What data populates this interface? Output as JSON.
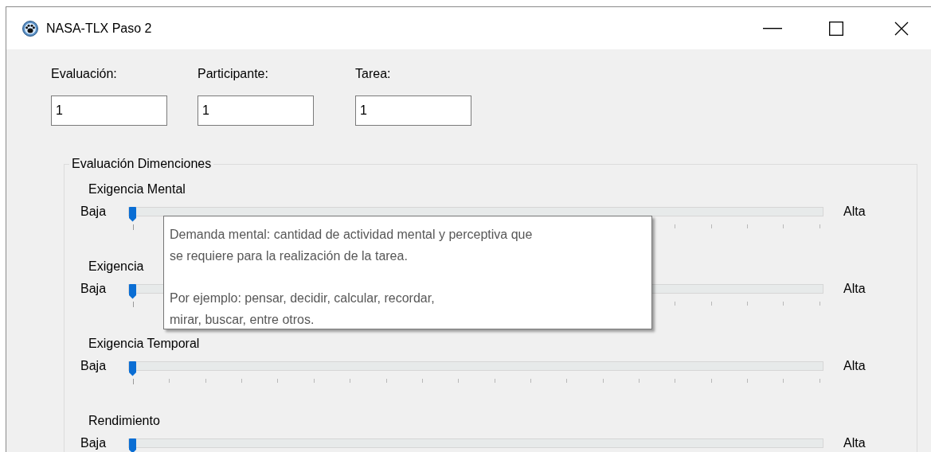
{
  "window": {
    "title": "NASA-TLX Paso 2"
  },
  "fields": [
    {
      "label": "Evaluación:",
      "value": "1"
    },
    {
      "label": "Participante:",
      "value": "1"
    },
    {
      "label": "Tarea:",
      "value": "1"
    }
  ],
  "group": {
    "title": "Evaluación Dimenciones",
    "scales": [
      {
        "name": "Exigencia Mental",
        "low": "Baja",
        "high": "Alta",
        "level": 0
      },
      {
        "name": "Exigencia",
        "low": "Baja",
        "high": "Alta",
        "level": 0
      },
      {
        "name": "Exigencia Temporal",
        "low": "Baja",
        "high": "Alta",
        "level": 0
      },
      {
        "name": "Rendimiento",
        "low": "Baja",
        "high": "Alta",
        "level": 0
      }
    ]
  },
  "tooltip": {
    "paragraphs": [
      "Demanda mental: cantidad de actividad mental y perceptiva que\nse requiere para la realización de la tarea.",
      "Por ejemplo: pensar, decidir, calcular, recordar,\nmirar, buscar, entre otros."
    ]
  }
}
